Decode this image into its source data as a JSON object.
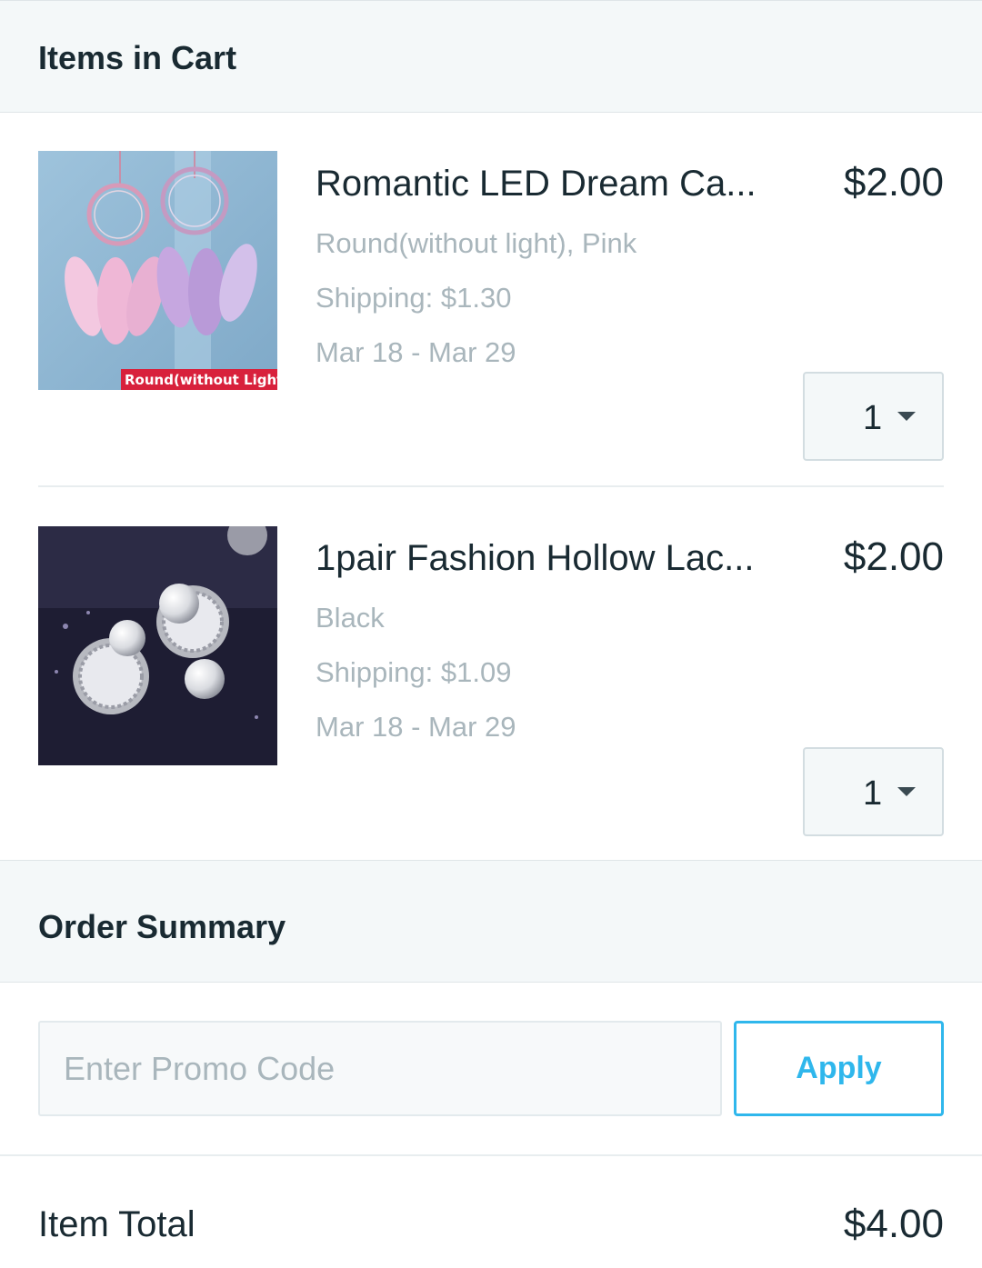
{
  "cart_header": {
    "title": "Items in Cart"
  },
  "items": [
    {
      "name": "Romantic LED Dream Ca...",
      "price": "$2.00",
      "variant": "Round(without light), Pink",
      "shipping": "Shipping: $1.30",
      "delivery": "Mar 18 - Mar 29",
      "quantity": "1",
      "image_label": "Round(without Light)"
    },
    {
      "name": "1pair Fashion Hollow Lac...",
      "price": "$2.00",
      "variant": "Black",
      "shipping": "Shipping: $1.09",
      "delivery": "Mar 18 - Mar 29",
      "quantity": "1"
    }
  ],
  "summary_header": {
    "title": "Order Summary"
  },
  "promo": {
    "placeholder": "Enter Promo Code",
    "apply_label": "Apply"
  },
  "totals": {
    "item_total_label": "Item Total",
    "item_total_value": "$4.00"
  },
  "colors": {
    "accent": "#2fb7ec",
    "text": "#192a32",
    "muted": "#a9b6bc",
    "header_bg": "#f4f8f9"
  }
}
